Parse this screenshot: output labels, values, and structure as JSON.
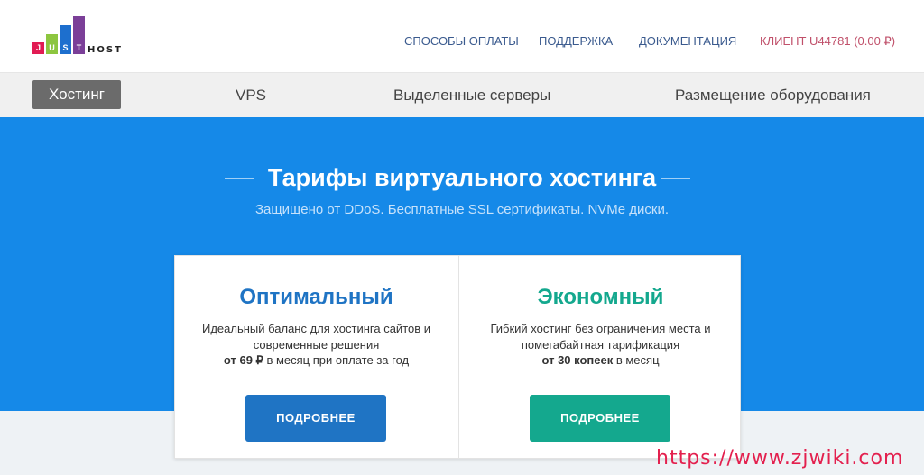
{
  "header": {
    "logo": {
      "letters": [
        "J",
        "U",
        "S",
        "T"
      ],
      "host": "HOST",
      "colors": [
        "#e11b53",
        "#8dc63f",
        "#1d6fce",
        "#7b3f98"
      ]
    },
    "links": [
      {
        "label": "СПОСОБЫ ОПЛАТЫ"
      },
      {
        "label": "ПОДДЕРЖКА"
      },
      {
        "label": "ДОКУМЕНТАЦИЯ"
      }
    ],
    "client": "КЛИЕНТ U44781 (0.00 ₽)"
  },
  "menu": {
    "items": [
      {
        "label": "Хостинг",
        "active": true
      },
      {
        "label": "VPS"
      },
      {
        "label": "Выделенные серверы"
      },
      {
        "label": "Размещение оборудования"
      }
    ]
  },
  "hero": {
    "title": "Тарифы виртуального хостинга",
    "subtitle": "Защищено от DDoS. Бесплатные SSL сертификаты. NVMe диски."
  },
  "plans": [
    {
      "title": "Оптимальный",
      "desc": "Идеальный баланс для хостинга сайтов и современные решения",
      "price_prefix": "от 69 ₽",
      "price_suffix": " в месяц при оплате за год",
      "button": "ПОДРОБНЕЕ",
      "color": "#1f74c4"
    },
    {
      "title": "Экономный",
      "desc": "Гибкий хостинг без ограничения места и помегабайтная тарификация",
      "price_prefix": "от 30 копеек",
      "price_suffix": " в месяц",
      "button": "ПОДРОБНЕЕ",
      "color": "#14a88e"
    }
  ],
  "watermark": "https://www.zjwiki.com"
}
